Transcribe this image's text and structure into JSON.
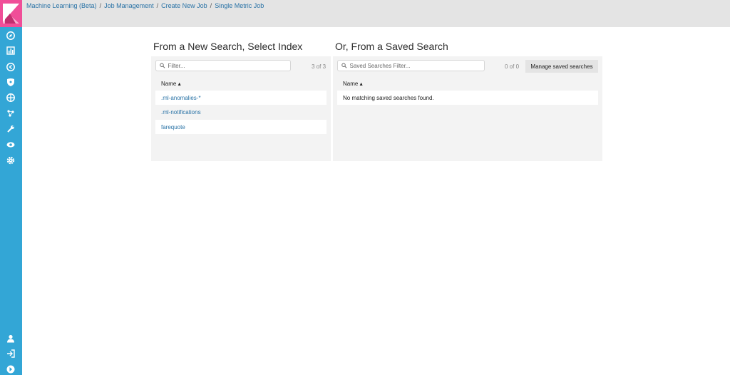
{
  "breadcrumbs": [
    "Machine Learning (Beta)",
    "Job Management",
    "Create New Job",
    "Single Metric Job"
  ],
  "sidebar": {
    "icons": [
      "compass-icon",
      "bar-chart-icon",
      "timelion-icon",
      "shield-icon",
      "ml-icon",
      "graph-icon",
      "wrench-icon",
      "eye-icon",
      "gear-icon"
    ],
    "bottom_icons": [
      "user-icon",
      "logout-icon",
      "collapse-icon"
    ]
  },
  "index_panel": {
    "title": "From a New Search, Select Index",
    "filter_placeholder": "Filter...",
    "count": "3 of 3",
    "column": "Name ▴",
    "items": [
      ".ml-anomalies-*",
      ".ml-notifications",
      "farequote"
    ]
  },
  "saved_panel": {
    "title": "Or, From a Saved Search",
    "filter_placeholder": "Saved Searches Filter...",
    "count": "0 of 0",
    "manage_label": "Manage saved searches",
    "column": "Name ▴",
    "empty_message": "No matching saved searches found."
  },
  "colors": {
    "sidebar": "#33a6d6",
    "logo": "#f04e98",
    "link": "#2a73a6"
  }
}
